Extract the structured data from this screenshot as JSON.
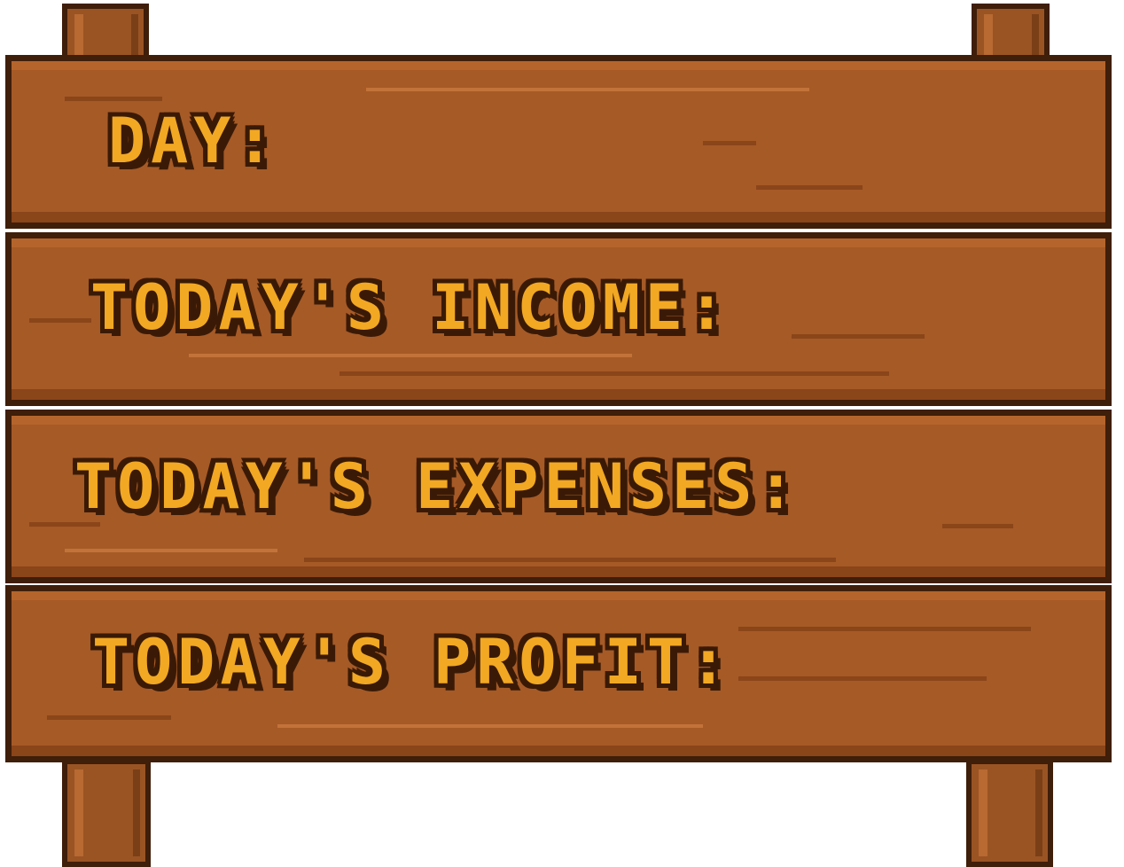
{
  "sign": {
    "day_label": "DAY:",
    "income_label": "TODAY'S INCOME:",
    "expenses_label": "TODAY'S EXPENSES:",
    "profit_label": "TODAY'S PROFIT:"
  },
  "colors": {
    "wood": "#a65a26",
    "wood_dark": "#8a4519",
    "outline": "#3f1e0a",
    "text": "#f2a823"
  }
}
